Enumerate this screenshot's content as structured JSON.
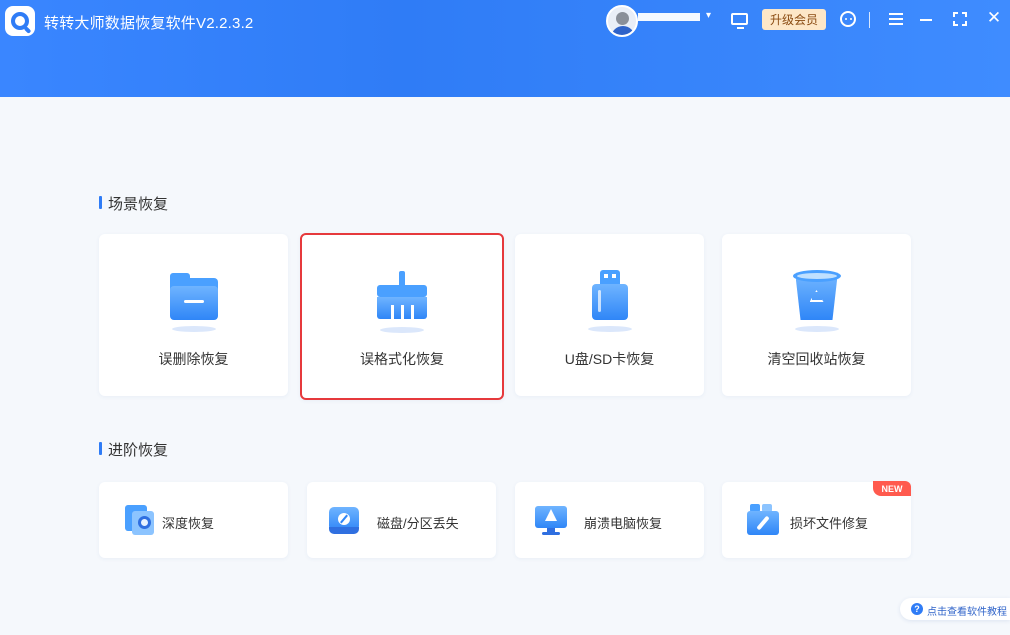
{
  "app": {
    "title": "转转大师数据恢复软件V2.2.3.2",
    "upgrade_label": "升级会员",
    "caret": "▾",
    "close_glyph": "✕"
  },
  "sections": {
    "scene_title": "场景恢复",
    "advanced_title": "进阶恢复"
  },
  "scene_cards": [
    {
      "label": "误删除恢复",
      "icon": "folder-icon",
      "selected": false
    },
    {
      "label": "误格式化恢复",
      "icon": "broom-icon",
      "selected": true
    },
    {
      "label": "U盘/SD卡恢复",
      "icon": "usb-drive-icon",
      "selected": false
    },
    {
      "label": "清空回收站恢复",
      "icon": "recycle-bin-icon",
      "selected": false
    }
  ],
  "advanced_cards": [
    {
      "label": "深度恢复",
      "icon": "deep-scan-icon"
    },
    {
      "label": "磁盘/分区丢失",
      "icon": "disk-icon"
    },
    {
      "label": "崩溃电脑恢复",
      "icon": "crashed-pc-icon"
    },
    {
      "label": "损坏文件修复",
      "icon": "file-repair-icon",
      "badge": "NEW"
    }
  ],
  "help": {
    "icon_glyph": "?",
    "label": "点击查看软件教程"
  },
  "colors": {
    "accent": "#2f7cf6",
    "selected_border": "#e6393c",
    "new_badge": "#ff5a4e",
    "upgrade_bg": "#fde7c8"
  }
}
